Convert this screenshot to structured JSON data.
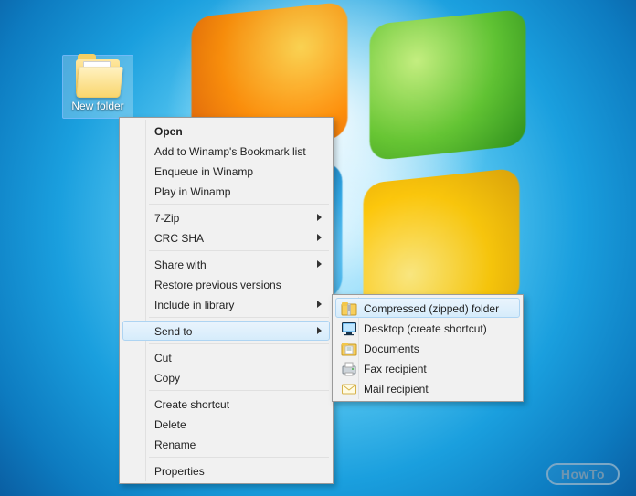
{
  "desktop": {
    "icon_label": "New folder"
  },
  "context_menu": {
    "open": "Open",
    "add_bookmark": "Add to Winamp's Bookmark list",
    "enqueue": "Enqueue in Winamp",
    "play": "Play in Winamp",
    "seven_zip": "7-Zip",
    "crc_sha": "CRC SHA",
    "share_with": "Share with",
    "restore": "Restore previous versions",
    "include_library": "Include in library",
    "send_to": "Send to",
    "cut": "Cut",
    "copy": "Copy",
    "create_shortcut": "Create shortcut",
    "delete": "Delete",
    "rename": "Rename",
    "properties": "Properties"
  },
  "send_to_submenu": {
    "compressed": "Compressed (zipped) folder",
    "desktop_shortcut": "Desktop (create shortcut)",
    "documents": "Documents",
    "fax": "Fax recipient",
    "mail": "Mail recipient"
  },
  "watermark": {
    "text": "HowTo"
  }
}
